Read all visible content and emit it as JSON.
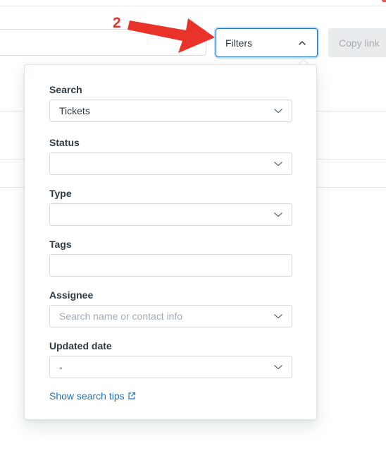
{
  "annotation": {
    "number": "2"
  },
  "toolbar": {
    "filters_label": "Filters",
    "copy_link_label": "Copy link"
  },
  "filters": {
    "search": {
      "label": "Search",
      "value": "Tickets"
    },
    "status": {
      "label": "Status",
      "value": ""
    },
    "type": {
      "label": "Type",
      "value": ""
    },
    "tags": {
      "label": "Tags",
      "value": ""
    },
    "assignee": {
      "label": "Assignee",
      "placeholder": "Search name or contact info"
    },
    "updated_date": {
      "label": "Updated date",
      "value": "-"
    },
    "tips_link": "Show search tips"
  },
  "colors": {
    "accent": "#1f73b7",
    "annotation": "#e8322a",
    "border": "#d8dcde"
  }
}
